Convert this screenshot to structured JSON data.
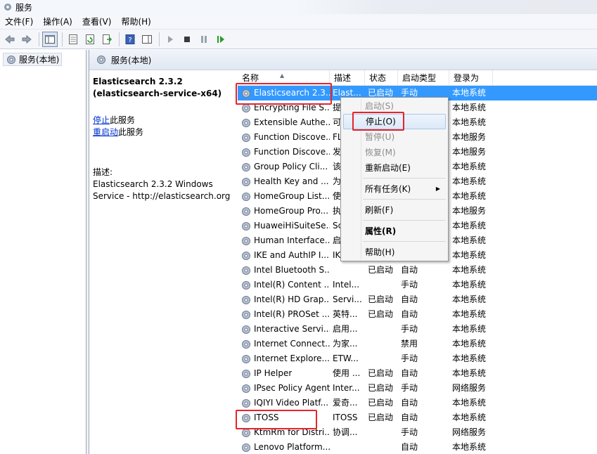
{
  "window": {
    "title": "服务"
  },
  "menubar": {
    "items": [
      "文件(F)",
      "操作(A)",
      "查看(V)",
      "帮助(H)"
    ]
  },
  "tree": {
    "item_label": "服务(本地)"
  },
  "pane": {
    "header": "服务(本地)"
  },
  "details": {
    "service_title": "Elasticsearch 2.3.2 (elasticsearch-service-x64)",
    "stop_link": "停止",
    "stop_suffix": "此服务",
    "restart_link": "重启动",
    "restart_suffix": "此服务",
    "description_label": "描述:",
    "description_text": "Elasticsearch 2.3.2 Windows Service - http://elasticsearch.org"
  },
  "table": {
    "columns": [
      "名称",
      "描述",
      "状态",
      "启动类型",
      "登录为"
    ],
    "rows": [
      {
        "name": "Elasticsearch 2.3...",
        "desc": "Elast...",
        "status": "已启动",
        "start": "手动",
        "logon": "本地系统"
      },
      {
        "name": "Encrypting File S...",
        "desc": "提",
        "status": "",
        "start": "",
        "logon": "本地系统"
      },
      {
        "name": "Extensible Authe...",
        "desc": "可",
        "status": "",
        "start": "",
        "logon": "本地系统"
      },
      {
        "name": "Function Discove...",
        "desc": "FL",
        "status": "",
        "start": "",
        "logon": "本地服务"
      },
      {
        "name": "Function Discove...",
        "desc": "发",
        "status": "",
        "start": "",
        "logon": "本地服务"
      },
      {
        "name": "Group Policy Cli...",
        "desc": "该",
        "status": "",
        "start": "",
        "logon": "本地系统"
      },
      {
        "name": "Health Key and ...",
        "desc": "为",
        "status": "",
        "start": "",
        "logon": "本地系统"
      },
      {
        "name": "HomeGroup List...",
        "desc": "使",
        "status": "",
        "start": "",
        "logon": "本地系统"
      },
      {
        "name": "HomeGroup Pro...",
        "desc": "执",
        "status": "",
        "start": "",
        "logon": "本地服务"
      },
      {
        "name": "HuaweiHiSuiteSe...",
        "desc": "Sc",
        "status": "",
        "start": "",
        "logon": "本地系统"
      },
      {
        "name": "Human Interface...",
        "desc": "启",
        "status": "",
        "start": "",
        "logon": "本地系统"
      },
      {
        "name": "IKE and AuthIP I...",
        "desc": "IK",
        "status": "",
        "start": "",
        "logon": "本地系统"
      },
      {
        "name": "Intel Bluetooth S...",
        "desc": "",
        "status": "已启动",
        "start": "自动",
        "logon": "本地系统"
      },
      {
        "name": "Intel(R) Content ...",
        "desc": "Intel...",
        "status": "",
        "start": "手动",
        "logon": "本地系统"
      },
      {
        "name": "Intel(R) HD Grap...",
        "desc": "Servi...",
        "status": "已启动",
        "start": "自动",
        "logon": "本地系统"
      },
      {
        "name": "Intel(R) PROSet ...",
        "desc": "英特...",
        "status": "已启动",
        "start": "自动",
        "logon": "本地系统"
      },
      {
        "name": "Interactive Servi...",
        "desc": "启用...",
        "status": "",
        "start": "手动",
        "logon": "本地系统"
      },
      {
        "name": "Internet Connect...",
        "desc": "为家...",
        "status": "",
        "start": "禁用",
        "logon": "本地系统"
      },
      {
        "name": "Internet Explore...",
        "desc": "ETW...",
        "status": "",
        "start": "手动",
        "logon": "本地系统"
      },
      {
        "name": "IP Helper",
        "desc": "使用 ...",
        "status": "已启动",
        "start": "自动",
        "logon": "本地系统"
      },
      {
        "name": "IPsec Policy Agent",
        "desc": "Inter...",
        "status": "已启动",
        "start": "手动",
        "logon": "网络服务"
      },
      {
        "name": "IQIYI Video Platf...",
        "desc": "爱奇...",
        "status": "已启动",
        "start": "自动",
        "logon": "本地系统"
      },
      {
        "name": "ITOSS",
        "desc": "ITOSS",
        "status": "已启动",
        "start": "自动",
        "logon": "本地系统"
      },
      {
        "name": "KtmRm for Distri...",
        "desc": "协调...",
        "status": "",
        "start": "手动",
        "logon": "网络服务"
      },
      {
        "name": "Lenovo Platform...",
        "desc": "",
        "status": "",
        "start": "自动",
        "logon": "本地系统"
      }
    ]
  },
  "context_menu": {
    "start": "启动(S)",
    "stop": "停止(O)",
    "pause": "暂停(U)",
    "resume": "恢复(M)",
    "restart": "重新启动(E)",
    "all_tasks": "所有任务(K)",
    "refresh": "刷新(F)",
    "properties": "属性(R)",
    "help": "帮助(H)"
  },
  "colors": {
    "selection": "#3399ff",
    "annotation": "#e8222a",
    "link": "#0033cc"
  }
}
